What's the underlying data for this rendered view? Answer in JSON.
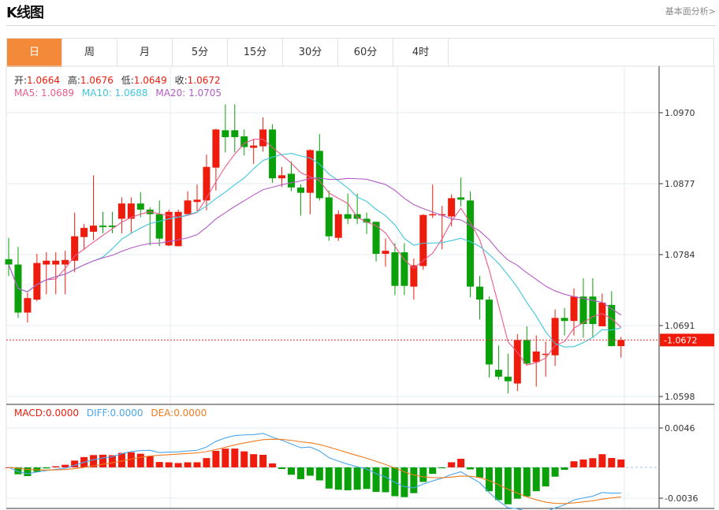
{
  "header": {
    "title": "K线图",
    "link": "基本面分析>"
  },
  "tabs": [
    {
      "label": "日",
      "active": true
    },
    {
      "label": "周"
    },
    {
      "label": "月"
    },
    {
      "label": "5分"
    },
    {
      "label": "15分"
    },
    {
      "label": "30分"
    },
    {
      "label": "60分"
    },
    {
      "label": "4时"
    }
  ],
  "ohlc_legend": {
    "open_label": "开:",
    "open": "1.0664",
    "high_label": "高:",
    "high": "1.0676",
    "low_label": "低:",
    "low": "1.0649",
    "close_label": "收:",
    "close": "1.0672"
  },
  "ma_legend": {
    "ma5": "MA5: 1.0689",
    "ma10": "MA10: 1.0688",
    "ma20": "MA20: 1.0705"
  },
  "macd_legend": {
    "macd": "MACD:0.0000",
    "diff": "DIFF:0.0000",
    "dea": "DEA:0.0000"
  },
  "colors": {
    "up": "#ee1c0c",
    "down": "#0aa00a",
    "ma5": "#ec5a8c",
    "ma10": "#3fc6dc",
    "ma20": "#b45cc6",
    "diff": "#4aa6ee",
    "dea": "#f07b1d",
    "accent": "#f28a3a"
  },
  "chart_data": {
    "type": "candlestick",
    "price_ticks": [
      "1.0970",
      "1.0877",
      "1.0784",
      "1.0691",
      "1.0598"
    ],
    "price_range": [
      1.0598,
      1.097
    ],
    "current_price": "1.0672",
    "macd_ticks": [
      "0.0046",
      "-0.0036"
    ],
    "macd_range": [
      -0.0036,
      0.0046
    ],
    "candles": [
      [
        1.0778,
        1.0806,
        1.0756,
        1.0771
      ],
      [
        1.0771,
        1.0794,
        1.0701,
        1.0708
      ],
      [
        1.0708,
        1.0734,
        1.0695,
        1.0727
      ],
      [
        1.0725,
        1.0785,
        1.0723,
        1.0773
      ],
      [
        1.0771,
        1.0787,
        1.0732,
        1.0776
      ],
      [
        1.0771,
        1.0787,
        1.0732,
        1.0776
      ],
      [
        1.0771,
        1.0789,
        1.0732,
        1.0777
      ],
      [
        1.0776,
        1.0839,
        1.0761,
        1.0808
      ],
      [
        1.0807,
        1.0824,
        1.079,
        1.0819
      ],
      [
        1.0814,
        1.0888,
        1.0803,
        1.0822
      ],
      [
        1.0822,
        1.084,
        1.0812,
        1.082
      ],
      [
        1.0822,
        1.084,
        1.0812,
        1.082
      ],
      [
        1.0831,
        1.0859,
        1.0812,
        1.0851
      ],
      [
        1.0831,
        1.0859,
        1.0812,
        1.0851
      ],
      [
        1.0851,
        1.0866,
        1.0833,
        1.0843
      ],
      [
        1.0843,
        1.0846,
        1.0796,
        1.0837
      ],
      [
        1.0837,
        1.0855,
        1.0795,
        1.0805
      ],
      [
        1.0796,
        1.0843,
        1.0795,
        1.084
      ],
      [
        1.0795,
        1.0843,
        1.0795,
        1.084
      ],
      [
        1.0837,
        1.0867,
        1.0837,
        1.0855
      ],
      [
        1.0853,
        1.0876,
        1.0841,
        1.0856
      ],
      [
        1.0855,
        1.0915,
        1.0842,
        1.0899
      ],
      [
        1.0898,
        1.0949,
        1.0868,
        1.0948
      ],
      [
        1.0947,
        1.0981,
        1.0918,
        1.0938
      ],
      [
        1.0947,
        1.0981,
        1.0918,
        1.0938
      ],
      [
        1.0939,
        1.0948,
        1.0914,
        1.0925
      ],
      [
        1.0924,
        1.0935,
        1.0903,
        1.0927
      ],
      [
        1.0926,
        1.0964,
        1.0919,
        1.0948
      ],
      [
        1.0948,
        1.0955,
        1.0878,
        1.0884
      ],
      [
        1.0884,
        1.0899,
        1.0873,
        1.0888
      ],
      [
        1.089,
        1.0906,
        1.0867,
        1.0872
      ],
      [
        1.0872,
        1.0876,
        1.0835,
        1.0865
      ],
      [
        1.0865,
        1.0922,
        1.0837,
        1.0921
      ],
      [
        1.092,
        1.0942,
        1.0855,
        1.0858
      ],
      [
        1.0859,
        1.0868,
        1.0802,
        1.0808
      ],
      [
        1.0806,
        1.0842,
        1.0802,
        1.0837
      ],
      [
        1.0837,
        1.0864,
        1.0824,
        1.0831
      ],
      [
        1.0837,
        1.0864,
        1.0824,
        1.0831
      ],
      [
        1.0831,
        1.0839,
        1.0811,
        1.0826
      ],
      [
        1.0827,
        1.0827,
        1.0775,
        1.0785
      ],
      [
        1.0785,
        1.0805,
        1.0768,
        1.0789
      ],
      [
        1.0787,
        1.0799,
        1.0731,
        1.0743
      ],
      [
        1.0787,
        1.0799,
        1.0731,
        1.0743
      ],
      [
        1.0742,
        1.0779,
        1.0725,
        1.077
      ],
      [
        1.0769,
        1.0837,
        1.0764,
        1.0836
      ],
      [
        1.0836,
        1.0876,
        1.0832,
        1.0837
      ],
      [
        1.0836,
        1.0848,
        1.0791,
        1.0837
      ],
      [
        1.0834,
        1.0863,
        1.0821,
        1.0858
      ],
      [
        1.0859,
        1.0885,
        1.0847,
        1.0856
      ],
      [
        1.0855,
        1.0867,
        1.0728,
        1.0742
      ],
      [
        1.0742,
        1.0756,
        1.0699,
        1.0725
      ],
      [
        1.0725,
        1.0729,
        1.0623,
        1.064
      ],
      [
        1.0633,
        1.0665,
        1.062,
        1.0624
      ],
      [
        1.0624,
        1.0654,
        1.0602,
        1.0618
      ],
      [
        1.0615,
        1.068,
        1.0605,
        1.0672
      ],
      [
        1.0672,
        1.069,
        1.064,
        1.0641
      ],
      [
        1.0643,
        1.0678,
        1.0611,
        1.0657
      ],
      [
        1.0653,
        1.067,
        1.0624,
        1.0654
      ],
      [
        1.0652,
        1.0712,
        1.0638,
        1.0701
      ],
      [
        1.0701,
        1.0714,
        1.0678,
        1.0697
      ],
      [
        1.0697,
        1.074,
        1.0678,
        1.0729
      ],
      [
        1.0729,
        1.0753,
        1.0675,
        1.0693
      ],
      [
        1.0729,
        1.0753,
        1.0675,
        1.0693
      ],
      [
        1.069,
        1.0733,
        1.069,
        1.0721
      ],
      [
        1.0718,
        1.0736,
        1.0664,
        1.0664
      ],
      [
        1.0664,
        1.0676,
        1.0649,
        1.0672
      ]
    ]
  }
}
